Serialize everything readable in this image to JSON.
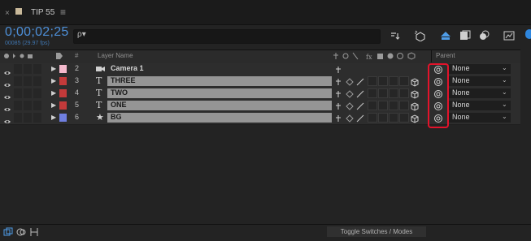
{
  "tab": {
    "close": "×",
    "title": "TIP 55",
    "menu": "≡"
  },
  "time": {
    "timecode": "0;00;02;25",
    "fps": "00085 (29.97 fps)"
  },
  "search": {
    "icon": "ρ▾"
  },
  "columns": {
    "layer_name": "Layer Name",
    "num": "#",
    "parent": "Parent"
  },
  "layers": [
    {
      "num": "2",
      "name": "Camera 1",
      "type": "camera",
      "type_glyph": "",
      "label_color": "#f4b9cc"
    },
    {
      "num": "3",
      "name": "THREE",
      "type": "text",
      "type_glyph": "T",
      "label_color": "#c43a3a"
    },
    {
      "num": "4",
      "name": "TWO",
      "type": "text",
      "type_glyph": "T",
      "label_color": "#c43a3a"
    },
    {
      "num": "5",
      "name": "ONE",
      "type": "text",
      "type_glyph": "T",
      "label_color": "#c43a3a"
    },
    {
      "num": "6",
      "name": "BG",
      "type": "shape",
      "type_glyph": "★",
      "label_color": "#6f7fe0"
    }
  ],
  "parent": {
    "value": "None",
    "chevron": "⌄"
  },
  "bottom": {
    "toggle_label": "Toggle Switches / Modes"
  },
  "colors": {
    "accent": "#4d8fd8",
    "highlight": "#e3132b",
    "tab_swatch": "#c9b99a"
  }
}
